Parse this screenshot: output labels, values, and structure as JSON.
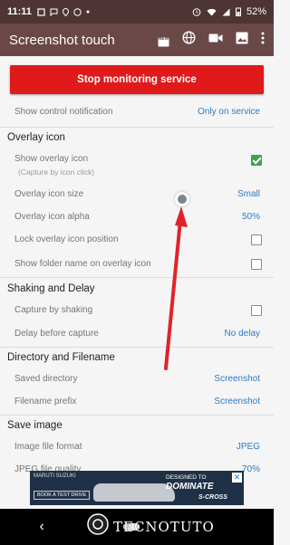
{
  "status_bar": {
    "time": "11:11",
    "battery": "52%"
  },
  "app_bar": {
    "title": "Screenshot touch",
    "icons": [
      "new-badge-icon",
      "globe-icon",
      "video-camera-icon",
      "image-icon",
      "more-vertical-icon"
    ],
    "new_badge": "NEW"
  },
  "stop_button": {
    "label": "Stop monitoring service"
  },
  "settings": {
    "notification": {
      "label": "Show control notification",
      "value": "Only on service"
    },
    "overlay_section": "Overlay icon",
    "show_overlay": {
      "label": "Show overlay icon",
      "sub": "(Capture by icon click)",
      "checked": true
    },
    "overlay_size": {
      "label": "Overlay icon size",
      "value": "Small"
    },
    "overlay_alpha": {
      "label": "Overlay icon alpha",
      "value": "50%"
    },
    "lock_position": {
      "label": "Lock overlay icon position",
      "checked": false
    },
    "show_folder": {
      "label": "Show folder name on overlay icon",
      "checked": false
    },
    "shaking_section": "Shaking and Delay",
    "capture_shaking": {
      "label": "Capture by shaking",
      "checked": false
    },
    "delay": {
      "label": "Delay before capture",
      "value": "No delay"
    },
    "directory_section": "Directory and Filename",
    "saved_directory": {
      "label": "Saved directory",
      "value": "Screenshot"
    },
    "filename_prefix": {
      "label": "Filename prefix",
      "value": "Screenshot"
    },
    "save_image_section": "Save image",
    "image_format": {
      "label": "Image file format",
      "value": "JPEG"
    },
    "jpeg_quality": {
      "label": "JPEG file quality",
      "value": "70%"
    }
  },
  "ad": {
    "brand": "MARUTI SUZUKI",
    "cta": "BOOK A TEST DRIVE",
    "headline_1": "DESIGNED TO",
    "headline_2": "DOMINATE",
    "model": "S-CROSS",
    "close": "✕"
  },
  "watermark": {
    "text": "TECNOTUTO"
  },
  "nav_bar": {
    "back": "‹"
  },
  "colors": {
    "status_bar": "#4e3434",
    "app_bar": "#6b4848",
    "stop_button": "#e01a1a",
    "value_text": "#2e7bc4",
    "checkbox_on": "#3fa34d",
    "annotation_arrow": "#e0232a"
  }
}
